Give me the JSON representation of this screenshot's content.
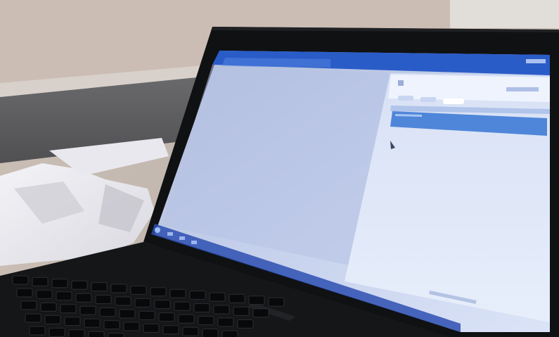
{
  "scene": {
    "subject": "laptop-on-desk",
    "screen": {
      "app_header": {},
      "left_pane": {},
      "right_pane": {
        "tabs": [
          "tab",
          "tab",
          "tab"
        ],
        "selected_row": true
      },
      "taskbar": {
        "start_button": "start-orb-icon",
        "pinned_icons": [
          "taskbar-icon",
          "taskbar-icon",
          "taskbar-icon"
        ]
      }
    },
    "colors": {
      "wall": "#bdb2aa",
      "desk": "#5b5b5d",
      "paper": "#eae9ee",
      "bezel": "#0f1113",
      "screen": "#b9c6e7",
      "header_blue": "#2a5cc8",
      "selection_blue": "#4f86d9",
      "keyboard": "#151618"
    }
  }
}
